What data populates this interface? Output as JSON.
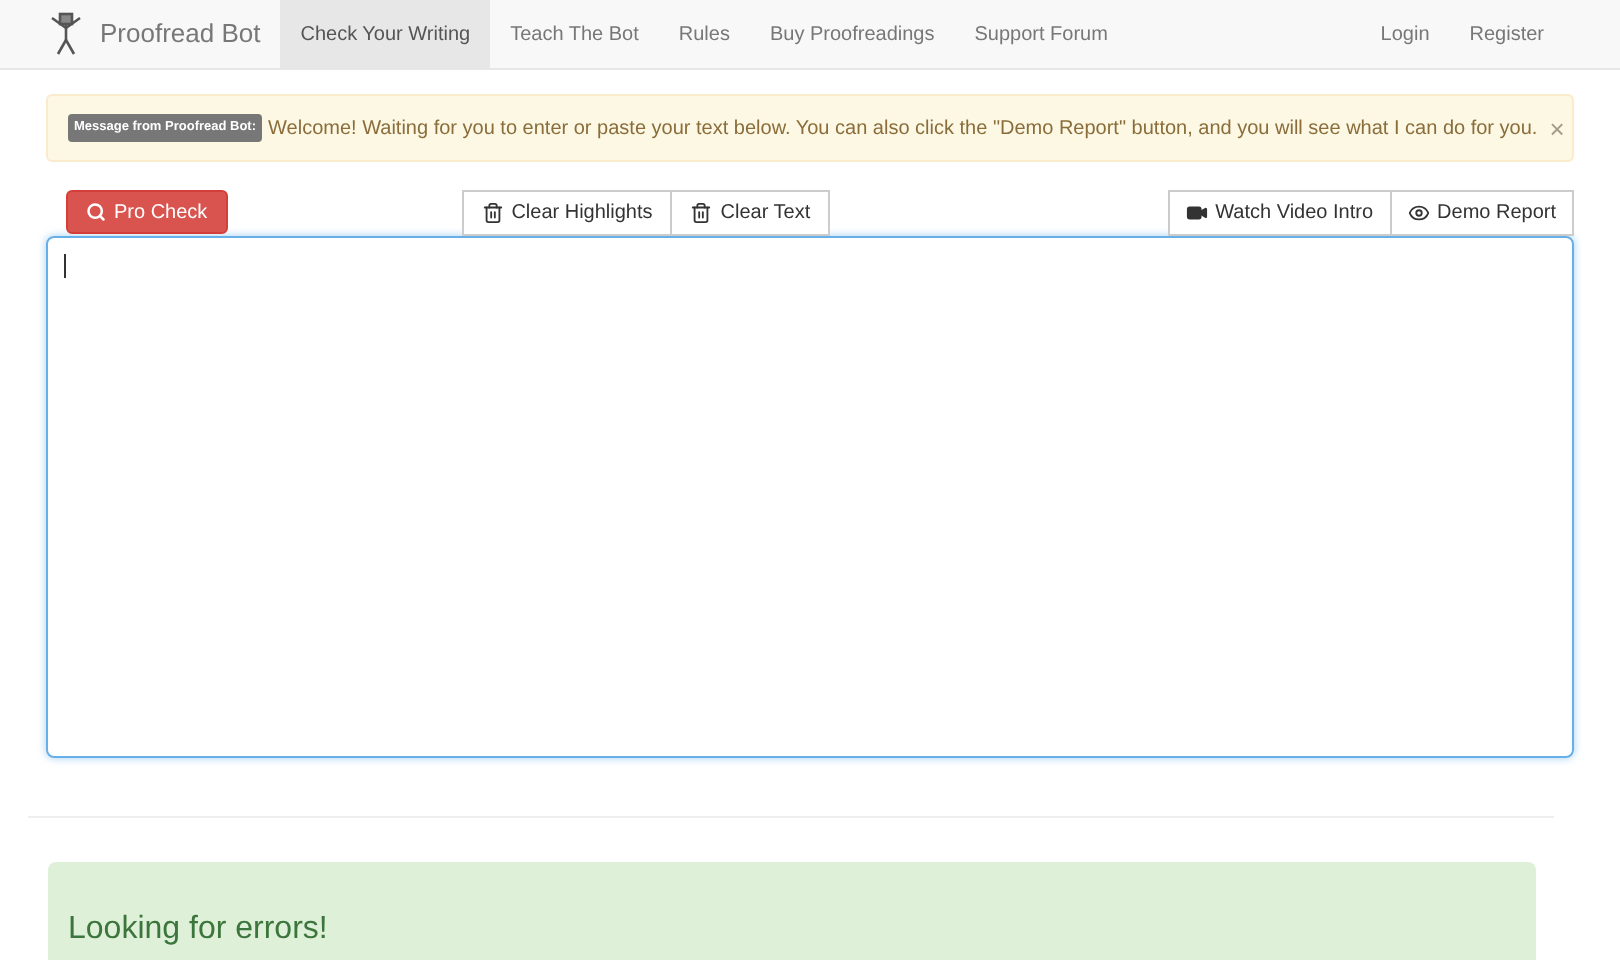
{
  "navbar": {
    "brand": "Proofread Bot",
    "items": [
      {
        "label": "Check Your Writing",
        "selected": true
      },
      {
        "label": "Teach The Bot",
        "selected": false
      },
      {
        "label": "Rules",
        "selected": false
      },
      {
        "label": "Buy Proofreadings",
        "selected": false
      },
      {
        "label": "Support Forum",
        "selected": false
      }
    ],
    "right_items": [
      "Login",
      "Register"
    ]
  },
  "alert": {
    "badge": "Message from Proofread Bot:",
    "message": "Welcome! Waiting for you to enter or paste your text below. You can also click the \"Demo Report\" button, and you will see what I can do for you.",
    "close": "×"
  },
  "toolbar": {
    "primary": "Pro Check",
    "middle": [
      "Clear Highlights",
      "Clear Text"
    ],
    "right": [
      {
        "label": "Watch Video Intro",
        "kind": "video"
      },
      {
        "label": "Demo Report",
        "kind": "eye"
      }
    ]
  },
  "result": {
    "title": "Looking for errors!"
  }
}
